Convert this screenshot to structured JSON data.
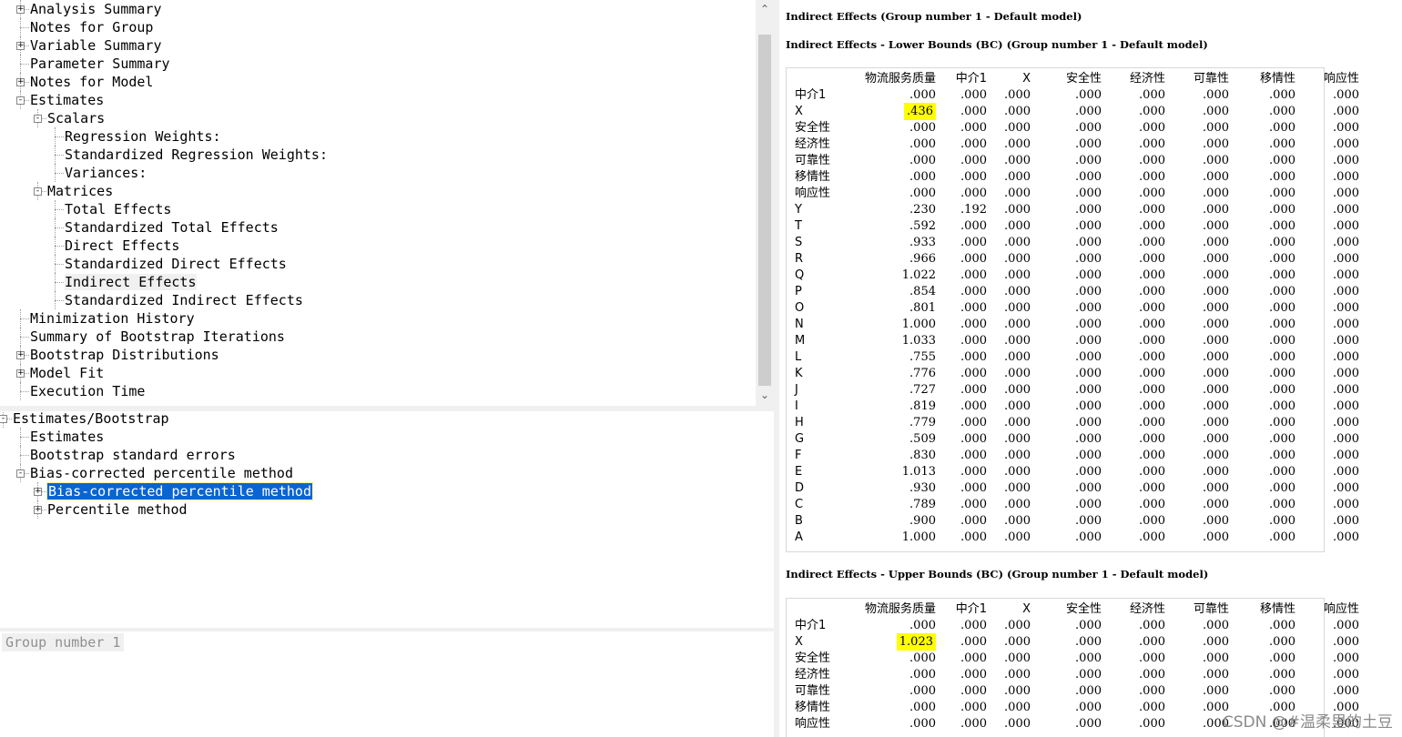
{
  "tree": {
    "items": [
      {
        "label": "Analysis Summary",
        "level": 0,
        "expander": "+"
      },
      {
        "label": "Notes for Group",
        "level": 0,
        "expander": ""
      },
      {
        "label": "Variable Summary",
        "level": 0,
        "expander": "+"
      },
      {
        "label": "Parameter Summary",
        "level": 0,
        "expander": ""
      },
      {
        "label": "Notes for Model",
        "level": 0,
        "expander": "+"
      },
      {
        "label": "Estimates",
        "level": 0,
        "expander": "-"
      },
      {
        "label": "Scalars",
        "level": 1,
        "expander": "-"
      },
      {
        "label": "Regression Weights:",
        "level": 2,
        "expander": ""
      },
      {
        "label": "Standardized Regression Weights:",
        "level": 2,
        "expander": ""
      },
      {
        "label": "Variances:",
        "level": 2,
        "expander": ""
      },
      {
        "label": "Matrices",
        "level": 1,
        "expander": "-"
      },
      {
        "label": "Total Effects",
        "level": 2,
        "expander": ""
      },
      {
        "label": "Standardized Total Effects",
        "level": 2,
        "expander": ""
      },
      {
        "label": "Direct Effects",
        "level": 2,
        "expander": ""
      },
      {
        "label": "Standardized Direct Effects",
        "level": 2,
        "expander": ""
      },
      {
        "label": "Indirect Effects",
        "level": 2,
        "expander": "",
        "highlight": true
      },
      {
        "label": "Standardized Indirect Effects",
        "level": 2,
        "expander": ""
      },
      {
        "label": "Minimization History",
        "level": 0,
        "expander": ""
      },
      {
        "label": "Summary of Bootstrap Iterations",
        "level": 0,
        "expander": ""
      },
      {
        "label": "Bootstrap Distributions",
        "level": 0,
        "expander": "+"
      },
      {
        "label": "Model Fit",
        "level": 0,
        "expander": "+"
      },
      {
        "label": "Execution Time",
        "level": 0,
        "expander": ""
      }
    ]
  },
  "bootstrap_tree": {
    "items": [
      {
        "label": "Estimates/Bootstrap",
        "level": 0,
        "expander": "-"
      },
      {
        "label": "Estimates",
        "level": 1,
        "expander": ""
      },
      {
        "label": "Bootstrap standard errors",
        "level": 1,
        "expander": ""
      },
      {
        "label": "Bias-corrected percentile method",
        "level": 1,
        "expander": "-"
      },
      {
        "label": "Bias-corrected percentile method",
        "level": 2,
        "expander": "+",
        "selected": true
      },
      {
        "label": "Percentile method",
        "level": 2,
        "expander": "+"
      }
    ]
  },
  "group_panel": {
    "label": "Group number 1"
  },
  "output": {
    "title_main": "Indirect Effects (Group number 1 - Default model)",
    "title_lower": "Indirect Effects - Lower Bounds (BC) (Group number 1 - Default model)",
    "title_upper": "Indirect Effects - Upper Bounds (BC) (Group number 1 - Default model)",
    "columns": [
      "物流服务质量",
      "中介1",
      "X",
      "安全性",
      "经济性",
      "可靠性",
      "移情性",
      "响应性"
    ],
    "lower_rows": [
      {
        "label": "中介1",
        "values": [
          ".000",
          ".000",
          ".000",
          ".000",
          ".000",
          ".000",
          ".000",
          ".000"
        ]
      },
      {
        "label": "X",
        "values": [
          ".436",
          ".000",
          ".000",
          ".000",
          ".000",
          ".000",
          ".000",
          ".000"
        ],
        "highlight": 0
      },
      {
        "label": "安全性",
        "values": [
          ".000",
          ".000",
          ".000",
          ".000",
          ".000",
          ".000",
          ".000",
          ".000"
        ]
      },
      {
        "label": "经济性",
        "values": [
          ".000",
          ".000",
          ".000",
          ".000",
          ".000",
          ".000",
          ".000",
          ".000"
        ]
      },
      {
        "label": "可靠性",
        "values": [
          ".000",
          ".000",
          ".000",
          ".000",
          ".000",
          ".000",
          ".000",
          ".000"
        ]
      },
      {
        "label": "移情性",
        "values": [
          ".000",
          ".000",
          ".000",
          ".000",
          ".000",
          ".000",
          ".000",
          ".000"
        ]
      },
      {
        "label": "响应性",
        "values": [
          ".000",
          ".000",
          ".000",
          ".000",
          ".000",
          ".000",
          ".000",
          ".000"
        ]
      },
      {
        "label": "Y",
        "values": [
          ".230",
          ".192",
          ".000",
          ".000",
          ".000",
          ".000",
          ".000",
          ".000"
        ]
      },
      {
        "label": "T",
        "values": [
          ".592",
          ".000",
          ".000",
          ".000",
          ".000",
          ".000",
          ".000",
          ".000"
        ]
      },
      {
        "label": "S",
        "values": [
          ".933",
          ".000",
          ".000",
          ".000",
          ".000",
          ".000",
          ".000",
          ".000"
        ]
      },
      {
        "label": "R",
        "values": [
          ".966",
          ".000",
          ".000",
          ".000",
          ".000",
          ".000",
          ".000",
          ".000"
        ]
      },
      {
        "label": "Q",
        "values": [
          "1.022",
          ".000",
          ".000",
          ".000",
          ".000",
          ".000",
          ".000",
          ".000"
        ]
      },
      {
        "label": "P",
        "values": [
          ".854",
          ".000",
          ".000",
          ".000",
          ".000",
          ".000",
          ".000",
          ".000"
        ]
      },
      {
        "label": "O",
        "values": [
          ".801",
          ".000",
          ".000",
          ".000",
          ".000",
          ".000",
          ".000",
          ".000"
        ]
      },
      {
        "label": "N",
        "values": [
          "1.000",
          ".000",
          ".000",
          ".000",
          ".000",
          ".000",
          ".000",
          ".000"
        ]
      },
      {
        "label": "M",
        "values": [
          "1.033",
          ".000",
          ".000",
          ".000",
          ".000",
          ".000",
          ".000",
          ".000"
        ]
      },
      {
        "label": "L",
        "values": [
          ".755",
          ".000",
          ".000",
          ".000",
          ".000",
          ".000",
          ".000",
          ".000"
        ]
      },
      {
        "label": "K",
        "values": [
          ".776",
          ".000",
          ".000",
          ".000",
          ".000",
          ".000",
          ".000",
          ".000"
        ]
      },
      {
        "label": "J",
        "values": [
          ".727",
          ".000",
          ".000",
          ".000",
          ".000",
          ".000",
          ".000",
          ".000"
        ]
      },
      {
        "label": "I",
        "values": [
          ".819",
          ".000",
          ".000",
          ".000",
          ".000",
          ".000",
          ".000",
          ".000"
        ]
      },
      {
        "label": "H",
        "values": [
          ".779",
          ".000",
          ".000",
          ".000",
          ".000",
          ".000",
          ".000",
          ".000"
        ]
      },
      {
        "label": "G",
        "values": [
          ".509",
          ".000",
          ".000",
          ".000",
          ".000",
          ".000",
          ".000",
          ".000"
        ]
      },
      {
        "label": "F",
        "values": [
          ".830",
          ".000",
          ".000",
          ".000",
          ".000",
          ".000",
          ".000",
          ".000"
        ]
      },
      {
        "label": "E",
        "values": [
          "1.013",
          ".000",
          ".000",
          ".000",
          ".000",
          ".000",
          ".000",
          ".000"
        ]
      },
      {
        "label": "D",
        "values": [
          ".930",
          ".000",
          ".000",
          ".000",
          ".000",
          ".000",
          ".000",
          ".000"
        ]
      },
      {
        "label": "C",
        "values": [
          ".789",
          ".000",
          ".000",
          ".000",
          ".000",
          ".000",
          ".000",
          ".000"
        ]
      },
      {
        "label": "B",
        "values": [
          ".900",
          ".000",
          ".000",
          ".000",
          ".000",
          ".000",
          ".000",
          ".000"
        ]
      },
      {
        "label": "A",
        "values": [
          "1.000",
          ".000",
          ".000",
          ".000",
          ".000",
          ".000",
          ".000",
          ".000"
        ]
      }
    ],
    "upper_rows": [
      {
        "label": "中介1",
        "values": [
          ".000",
          ".000",
          ".000",
          ".000",
          ".000",
          ".000",
          ".000",
          ".000"
        ]
      },
      {
        "label": "X",
        "values": [
          "1.023",
          ".000",
          ".000",
          ".000",
          ".000",
          ".000",
          ".000",
          ".000"
        ],
        "highlight": 0
      },
      {
        "label": "安全性",
        "values": [
          ".000",
          ".000",
          ".000",
          ".000",
          ".000",
          ".000",
          ".000",
          ".000"
        ]
      },
      {
        "label": "经济性",
        "values": [
          ".000",
          ".000",
          ".000",
          ".000",
          ".000",
          ".000",
          ".000",
          ".000"
        ]
      },
      {
        "label": "可靠性",
        "values": [
          ".000",
          ".000",
          ".000",
          ".000",
          ".000",
          ".000",
          ".000",
          ".000"
        ]
      },
      {
        "label": "移情性",
        "values": [
          ".000",
          ".000",
          ".000",
          ".000",
          ".000",
          ".000",
          ".000",
          ".000"
        ]
      },
      {
        "label": "响应性",
        "values": [
          ".000",
          ".000",
          ".000",
          ".000",
          ".000",
          ".000",
          ".000",
          ".000"
        ]
      }
    ],
    "watermark": "CSDN @#温柔里的土豆"
  },
  "colors": {
    "selection": "#0a64d2",
    "highlight": "#ffff00",
    "panel_bg": "#f0f0f0"
  }
}
